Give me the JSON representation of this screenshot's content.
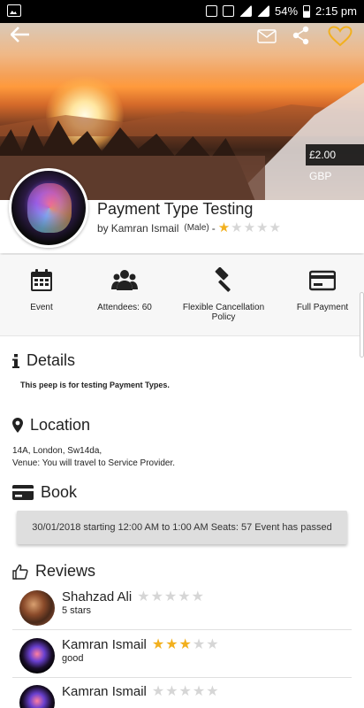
{
  "status_bar": {
    "battery": "54%",
    "time": "2:15 pm"
  },
  "hero": {
    "price": "£2.00 GBP"
  },
  "event": {
    "title": "Payment Type Testing",
    "by_prefix": "by",
    "host": "Kamran Ismail",
    "gender": "(Male)",
    "separator": "-",
    "rating": 1,
    "max_rating": 5
  },
  "features": [
    {
      "label": "Event",
      "icon": "calendar-icon"
    },
    {
      "label": "Attendees: 60",
      "icon": "users-icon"
    },
    {
      "label": "Flexible Cancellation Policy",
      "icon": "gavel-icon"
    },
    {
      "label": "Full Payment",
      "icon": "credit-card-icon"
    }
  ],
  "details": {
    "title": "Details",
    "text": "This peep is for testing Payment Types."
  },
  "location": {
    "title": "Location",
    "address": "14A, London, Sw14da,",
    "venue": "Venue: You will travel to Service Provider."
  },
  "book": {
    "title": "Book",
    "slot": "30/01/2018 starting 12:00 AM to 1:00 AM Seats: 57 Event has passed"
  },
  "reviews": {
    "title": "Reviews",
    "items": [
      {
        "name": "Shahzad Ali",
        "rating": 0,
        "text": "5 stars"
      },
      {
        "name": "Kamran Ismail",
        "rating": 3,
        "text": "good"
      },
      {
        "name": "Kamran Ismail",
        "rating": 0,
        "text": ""
      }
    ]
  },
  "colors": {
    "star_on": "#f2b01e",
    "star_off": "#d6d6d6",
    "heart": "#f2b01e"
  }
}
